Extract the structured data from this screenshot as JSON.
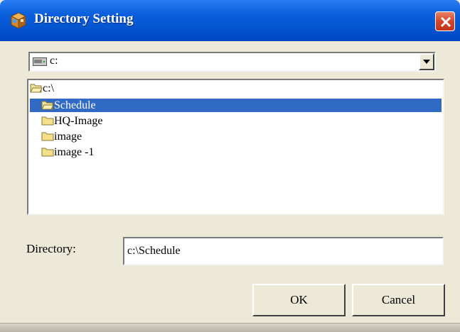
{
  "window": {
    "title": "Directory Setting",
    "icon": "settings-cube-icon",
    "close_icon": "close-icon"
  },
  "drive_select": {
    "value": "c:",
    "icon": "drive-icon",
    "arrow_icon": "chevron-down-icon"
  },
  "tree": {
    "items": [
      {
        "label": "c:\\",
        "icon": "open-folder-icon",
        "selected": false
      },
      {
        "label": "Schedule",
        "icon": "open-folder-icon",
        "selected": true
      },
      {
        "label": "HQ-Image",
        "icon": "folder-icon",
        "selected": false
      },
      {
        "label": "image",
        "icon": "folder-icon",
        "selected": false
      },
      {
        "label": "image -1",
        "icon": "folder-icon",
        "selected": false
      }
    ]
  },
  "directory": {
    "label": "Directory:",
    "value": "c:\\Schedule"
  },
  "buttons": {
    "ok": "OK",
    "cancel": "Cancel"
  },
  "colors": {
    "titlebar": "#0a5fdd",
    "selection": "#316ac5",
    "panel": "#ece9d8",
    "close": "#d8442a"
  }
}
